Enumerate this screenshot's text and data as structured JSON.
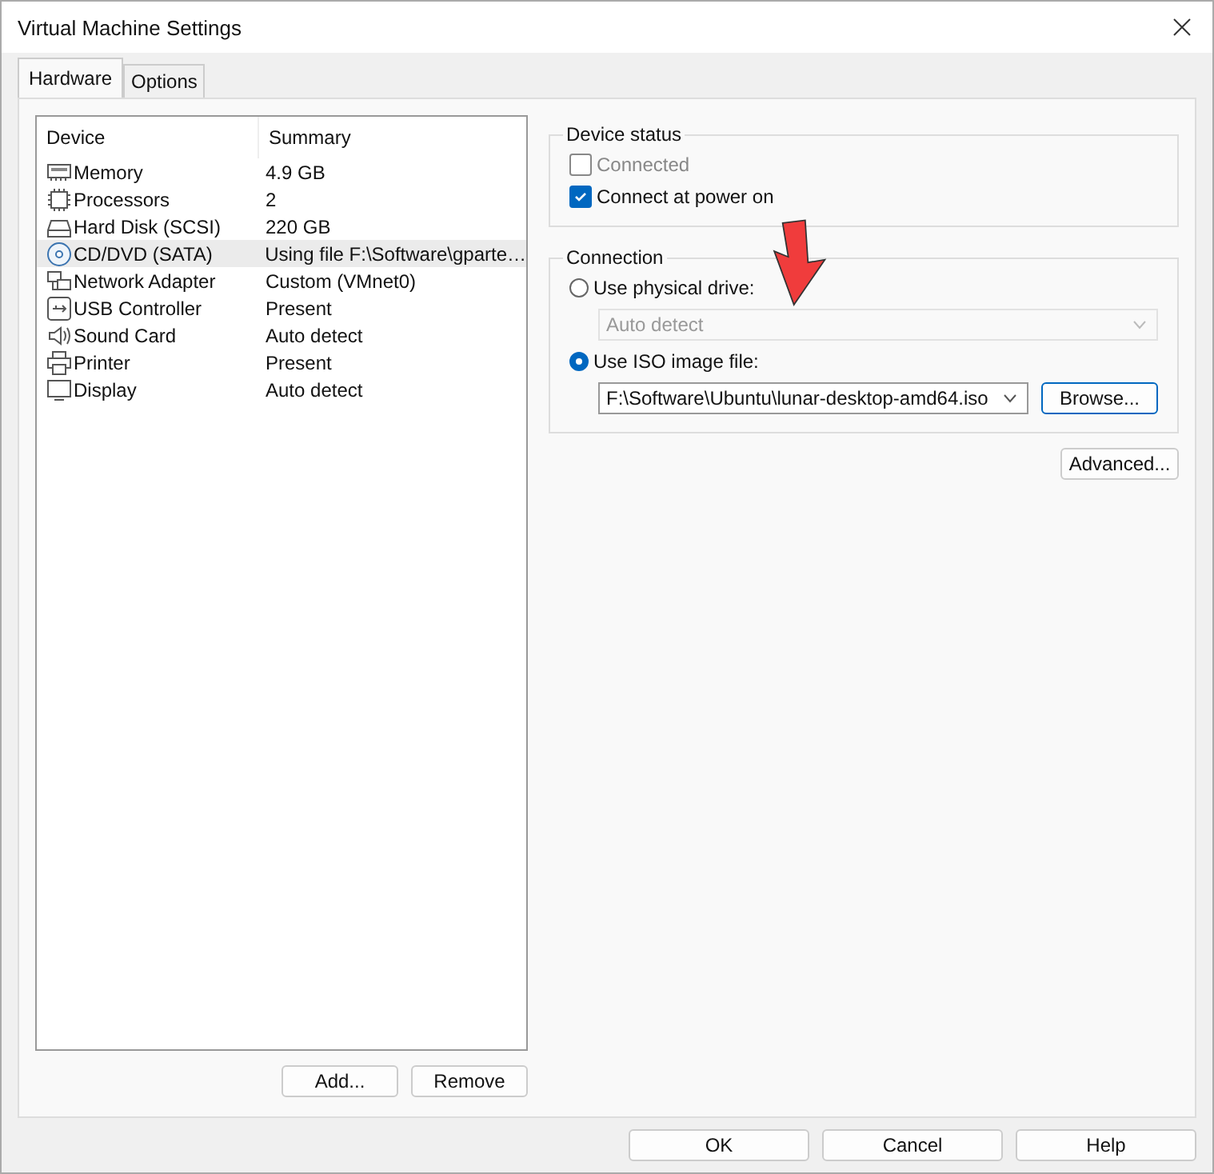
{
  "window": {
    "title": "Virtual Machine Settings"
  },
  "tabs": [
    {
      "label": "Hardware",
      "selected": true
    },
    {
      "label": "Options",
      "selected": false
    }
  ],
  "device_list": {
    "columns": [
      "Device",
      "Summary"
    ],
    "rows": [
      {
        "kind": "memory",
        "device": "Memory",
        "summary": "4.9 GB",
        "selected": false
      },
      {
        "kind": "processor",
        "device": "Processors",
        "summary": "2",
        "selected": false
      },
      {
        "kind": "disk",
        "device": "Hard Disk (SCSI)",
        "summary": "220 GB",
        "selected": false
      },
      {
        "kind": "cd",
        "device": "CD/DVD (SATA)",
        "summary": "Using file F:\\Software\\gparte…",
        "selected": true
      },
      {
        "kind": "network",
        "device": "Network Adapter",
        "summary": "Custom (VMnet0)",
        "selected": false
      },
      {
        "kind": "usb",
        "device": "USB Controller",
        "summary": "Present",
        "selected": false
      },
      {
        "kind": "sound",
        "device": "Sound Card",
        "summary": "Auto detect",
        "selected": false
      },
      {
        "kind": "printer",
        "device": "Printer",
        "summary": "Present",
        "selected": false
      },
      {
        "kind": "display",
        "device": "Display",
        "summary": "Auto detect",
        "selected": false
      }
    ],
    "buttons": [
      "Add...",
      "Remove"
    ]
  },
  "device_status": {
    "title": "Device status",
    "options": [
      {
        "label": "Connected",
        "checked": false,
        "disabled": true
      },
      {
        "label": "Connect at power on",
        "checked": true,
        "disabled": false
      }
    ]
  },
  "connection": {
    "title": "Connection",
    "physical": {
      "label": "Use physical drive:",
      "selected": false,
      "dropdown": {
        "value": "Auto detect",
        "disabled": true
      }
    },
    "iso": {
      "label": "Use ISO image file:",
      "selected": true,
      "dropdown": {
        "value": "F:\\Software\\Ubuntu\\lunar-desktop-amd64.iso",
        "disabled": false
      },
      "browse": "Browse..."
    }
  },
  "advanced_button": "Advanced...",
  "footer_buttons": [
    "OK",
    "Cancel",
    "Help"
  ]
}
